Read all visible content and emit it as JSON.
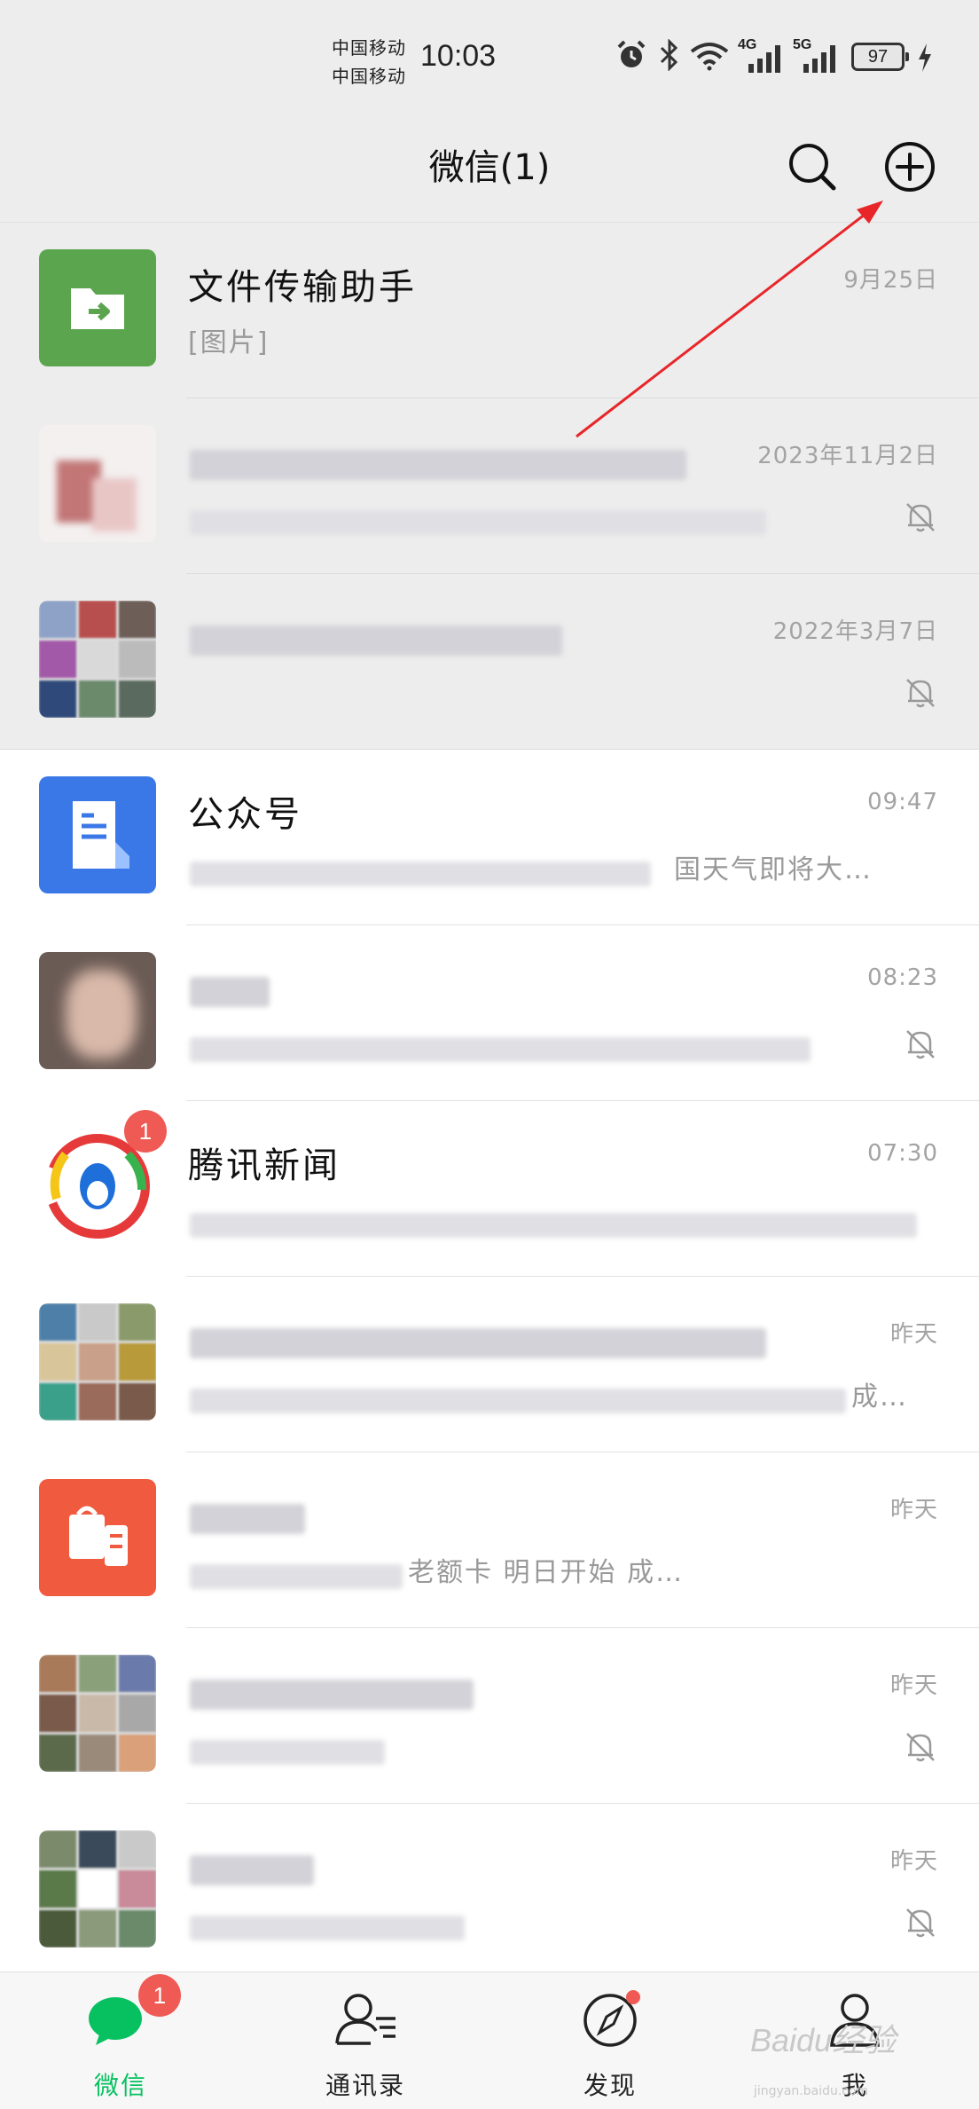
{
  "status_bar": {
    "carrier_1": "中国移动",
    "carrier_2": "中国移动",
    "time": "10:03",
    "net_4g": "4G",
    "net_5g": "5G",
    "battery": "97"
  },
  "header": {
    "title": "微信(1)"
  },
  "chats": [
    {
      "name": "文件传输助手",
      "message": "[图片]",
      "time": "9月25日"
    },
    {
      "name": "",
      "message": "",
      "time": "2023年11月2日"
    },
    {
      "name": "",
      "message": "",
      "time": "2022年3月7日"
    },
    {
      "name": "公众号",
      "message": "国天气即将大…",
      "time": "09:47"
    },
    {
      "name": "",
      "message": "",
      "time": "08:23"
    },
    {
      "name": "腾讯新闻",
      "message": "",
      "time": "07:30",
      "unread": "1"
    },
    {
      "name": "",
      "message": "成…",
      "time": "昨天"
    },
    {
      "name": "",
      "message": "老额卡 明日开始 成…",
      "time": "昨天"
    },
    {
      "name": "",
      "message": "",
      "time": "昨天"
    },
    {
      "name": "",
      "message": "",
      "time": "昨天"
    }
  ],
  "tabbar": {
    "items": [
      {
        "label": "微信",
        "badge": "1"
      },
      {
        "label": "通讯录"
      },
      {
        "label": "发现"
      },
      {
        "label": "我"
      }
    ]
  },
  "watermark": "Baidu经验",
  "watermark_sub": "jingyan.baidu.com",
  "colors": {
    "accent_green": "#07c160",
    "badge_red": "#f05a55",
    "annotation_red": "#e8262a",
    "header_bg": "#ededed"
  }
}
